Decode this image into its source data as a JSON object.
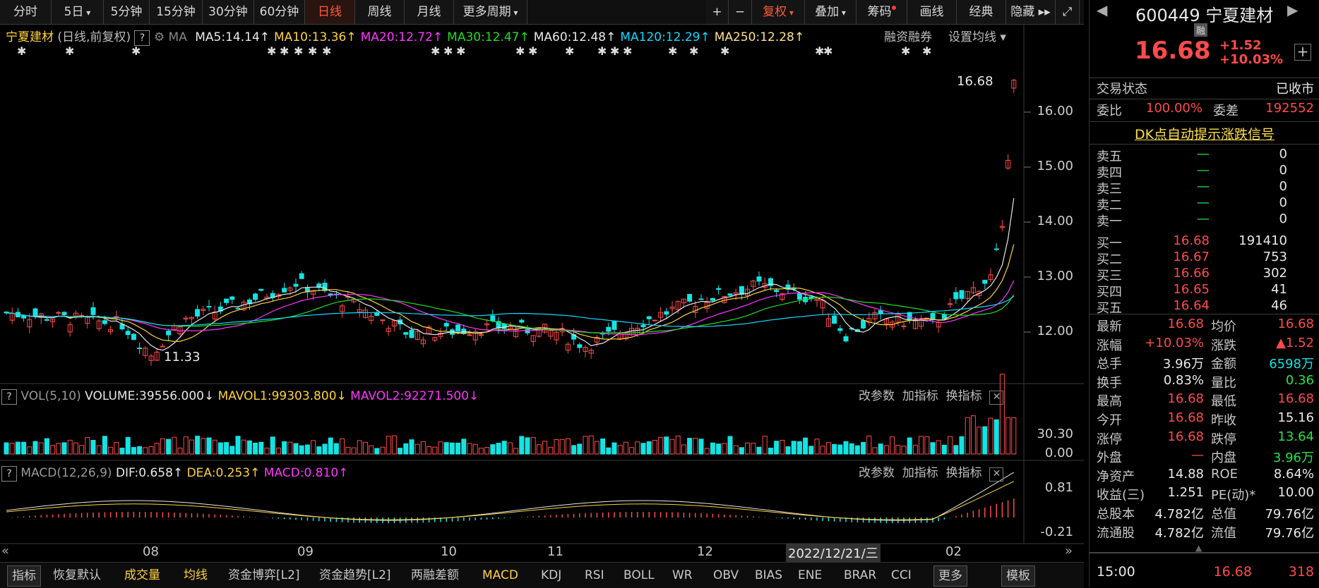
{
  "toolbar": {
    "periods": [
      "分时",
      "5日",
      "5分钟",
      "15分钟",
      "30分钟",
      "60分钟",
      "日线",
      "周线",
      "月线",
      "更多周期"
    ],
    "active_period": "日线",
    "plus": "+",
    "minus": "−",
    "fuquan": "复权",
    "diejia": "叠加",
    "chouma": "筹码",
    "huaxian": "画线",
    "jingdian": "经典",
    "yincang": "隐藏"
  },
  "main_chart": {
    "stock_name": "宁夏建材",
    "mode": "(日线,前复权)",
    "q": "?",
    "ma_label": "MA",
    "ma": [
      {
        "text": "MA5:14.14",
        "color": "#e8e8e8"
      },
      {
        "text": "MA10:13.36",
        "color": "#ffd23c"
      },
      {
        "text": "MA20:12.72",
        "color": "#ff36ff"
      },
      {
        "text": "MA30:12.47",
        "color": "#22dd22"
      },
      {
        "text": "MA60:12.48",
        "color": "#e8e8e8"
      },
      {
        "text": "MA120:12.29",
        "color": "#14d8ff"
      },
      {
        "text": "MA250:12.28",
        "color": "#ffe28a"
      }
    ],
    "margin_trading": "融资融券",
    "set_ma": "设置均线",
    "last_price_label": "16.68",
    "low_label": "11.33",
    "y_ticks": [
      "16.00",
      "15.00",
      "14.00",
      "13.00",
      "12.00"
    ]
  },
  "volume_panel": {
    "q": "?",
    "title": "VOL(5,10)",
    "volume": "VOLUME:39556.000",
    "mavol1": "MAVOL1:99303.800",
    "mavol2": "MAVOL2:92271.500",
    "tools": [
      "改参数",
      "加指标",
      "换指标"
    ],
    "y_ticks": [
      "30.30",
      "0.00"
    ]
  },
  "macd_panel": {
    "q": "?",
    "title": "MACD(12,26,9)",
    "dif": "DIF:0.658",
    "dea": "DEA:0.253",
    "macd": "MACD:0.810",
    "tools": [
      "改参数",
      "加指标",
      "换指标"
    ],
    "y_ticks": [
      "0.81",
      "-0.21"
    ]
  },
  "x_axis": {
    "months": [
      "08",
      "09",
      "10",
      "11",
      "12",
      "02"
    ],
    "cursor_date": "2022/12/21/三"
  },
  "bottom_tabs": [
    "指标",
    "恢复默认",
    "成交量",
    "均线",
    "资金博弈[L2]",
    "资金趋势[L2]",
    "两融差额",
    "MACD",
    "KDJ",
    "RSI",
    "BOLL",
    "WR",
    "OBV",
    "BIAS",
    "ENE",
    "BRAR",
    "CCI",
    "更多",
    "模板"
  ],
  "right_panel": {
    "code": "600449",
    "name": "宁夏建材",
    "badge": "融",
    "price": "16.68",
    "change": "+1.52",
    "change_pct": "+10.03%",
    "trade_status_label": "交易状态",
    "trade_status": "已收市",
    "weibi_label": "委比",
    "weibi": "100.00%",
    "weicha_label": "委差",
    "weicha": "192552",
    "dk_signal": "DK点自动提示涨跌信号",
    "asks": [
      {
        "label": "卖五",
        "price": "—",
        "vol": "0"
      },
      {
        "label": "卖四",
        "price": "—",
        "vol": "0"
      },
      {
        "label": "卖三",
        "price": "—",
        "vol": "0"
      },
      {
        "label": "卖二",
        "price": "—",
        "vol": "0"
      },
      {
        "label": "卖一",
        "price": "—",
        "vol": "0"
      }
    ],
    "bids": [
      {
        "label": "买一",
        "price": "16.68",
        "vol": "191410"
      },
      {
        "label": "买二",
        "price": "16.67",
        "vol": "753"
      },
      {
        "label": "买三",
        "price": "16.66",
        "vol": "302"
      },
      {
        "label": "买四",
        "price": "16.65",
        "vol": "41"
      },
      {
        "label": "买五",
        "price": "16.64",
        "vol": "46"
      }
    ],
    "stats": [
      {
        "l1": "最新",
        "v1": "16.68",
        "c1": "red",
        "l2": "均价",
        "v2": "16.68",
        "c2": "red"
      },
      {
        "l1": "涨幅",
        "v1": "+10.03%",
        "c1": "red",
        "l2": "涨跌",
        "v2": "▲1.52",
        "c2": "red"
      },
      {
        "l1": "总手",
        "v1": "3.96万",
        "c1": "white",
        "l2": "金额",
        "v2": "6598万",
        "c2": "cyan"
      },
      {
        "l1": "换手",
        "v1": "0.83%",
        "c1": "white",
        "l2": "量比",
        "v2": "0.36",
        "c2": "green"
      },
      {
        "l1": "最高",
        "v1": "16.68",
        "c1": "red",
        "l2": "最低",
        "v2": "16.68",
        "c2": "red"
      },
      {
        "l1": "今开",
        "v1": "16.68",
        "c1": "red",
        "l2": "昨收",
        "v2": "15.16",
        "c2": "white"
      },
      {
        "l1": "涨停",
        "v1": "16.68",
        "c1": "red",
        "l2": "跌停",
        "v2": "13.64",
        "c2": "green"
      },
      {
        "l1": "外盘",
        "v1": "—",
        "c1": "red",
        "l2": "内盘",
        "v2": "3.96万",
        "c2": "green"
      },
      {
        "l1": "净资产",
        "v1": "14.88",
        "c1": "white",
        "l2": "ROE",
        "v2": "8.64%",
        "c2": "white"
      },
      {
        "l1": "收益(三)",
        "v1": "1.251",
        "c1": "white",
        "l2": "PE(动)*",
        "v2": "10.00",
        "c2": "white"
      },
      {
        "l1": "总股本",
        "v1": "4.782亿",
        "c1": "white",
        "l2": "总值",
        "v2": "79.76亿",
        "c2": "white"
      },
      {
        "l1": "流通股",
        "v1": "4.782亿",
        "c1": "white",
        "l2": "流值",
        "v2": "79.76亿",
        "c2": "white"
      }
    ],
    "tick": {
      "time": "15:00",
      "price": "16.68",
      "vol": "318"
    }
  },
  "colors": {
    "up": "#ff4b4b",
    "down": "#14e3e3",
    "grid": "#2a2a2a"
  }
}
